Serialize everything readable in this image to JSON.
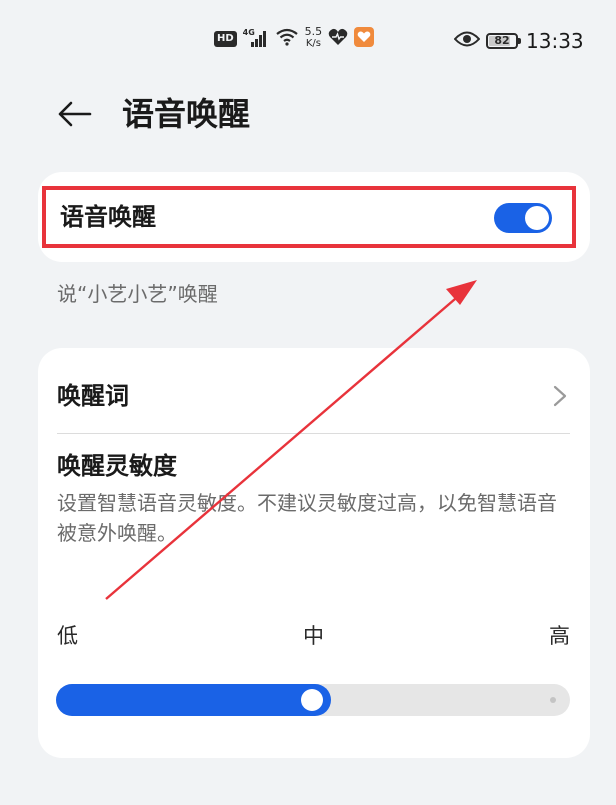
{
  "status_bar": {
    "hd": "HD",
    "network": "4G",
    "speed_value": "5.5",
    "speed_unit": "K/s",
    "battery": "82",
    "battery_level": 0.82,
    "time": "13:33"
  },
  "header": {
    "title": "语音唤醒"
  },
  "voice_wake": {
    "label": "语音唤醒",
    "enabled": true,
    "hint": "说“小艺小艺”唤醒"
  },
  "settings": {
    "wake_word_label": "唤醒词",
    "sensitivity_title": "唤醒灵敏度",
    "sensitivity_desc": "设置智慧语音灵敏度。不建议灵敏度过高，以免智慧语音被意外唤醒。",
    "scale": {
      "low": "低",
      "mid": "中",
      "high": "高"
    },
    "sensitivity_level": 0.5
  },
  "colors": {
    "accent": "#1a62e6",
    "highlight_red": "#e8333b",
    "background": "#f1f3f5"
  }
}
